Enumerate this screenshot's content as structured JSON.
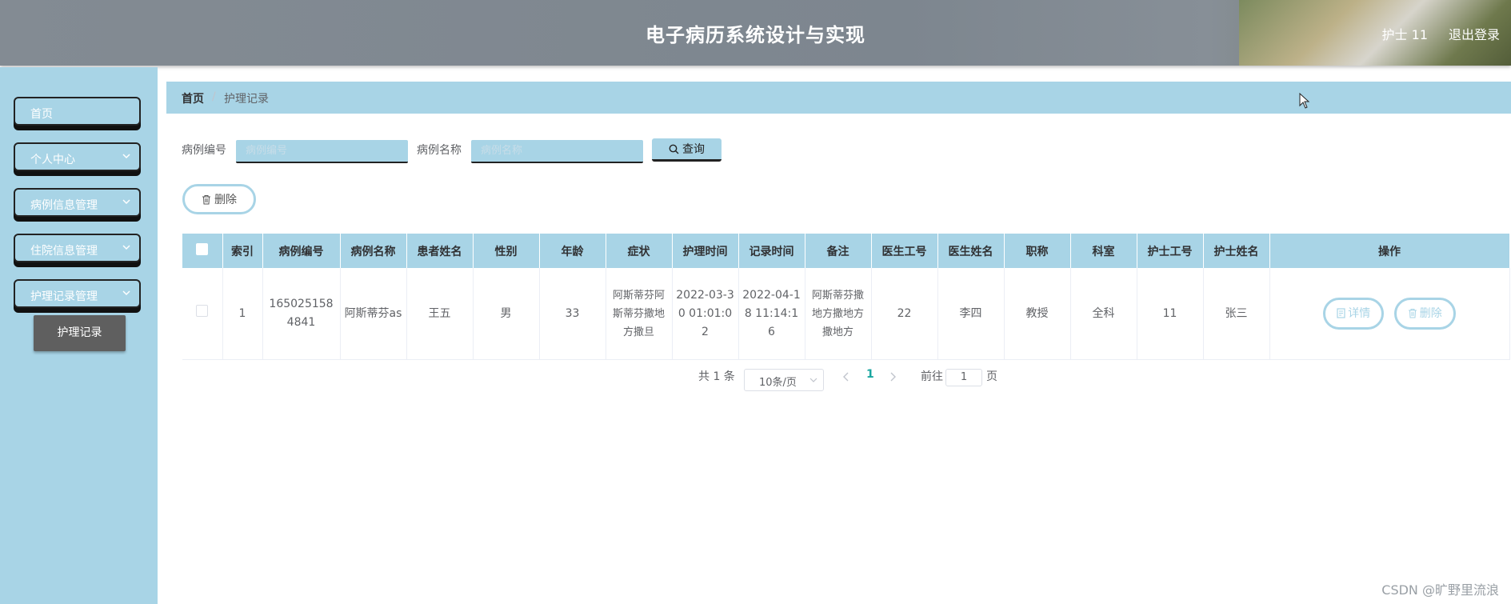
{
  "header": {
    "title": "电子病历系统设计与实现",
    "user": "护士 11",
    "logout": "退出登录"
  },
  "sidebar": {
    "items": [
      {
        "label": "首页"
      },
      {
        "label": "个人中心"
      },
      {
        "label": "病例信息管理"
      },
      {
        "label": "住院信息管理"
      },
      {
        "label": "护理记录管理"
      }
    ],
    "active_sub": "护理记录"
  },
  "breadcrumb": {
    "home": "首页",
    "current": "护理记录"
  },
  "search": {
    "field1_label": "病例编号",
    "field1_placeholder": "病例编号",
    "field2_label": "病例名称",
    "field2_placeholder": "病例名称",
    "query_label": "查询"
  },
  "toolbar": {
    "delete_label": "删除"
  },
  "table": {
    "columns": [
      "索引",
      "病例编号",
      "病例名称",
      "患者姓名",
      "性别",
      "年龄",
      "症状",
      "护理时间",
      "记录时间",
      "备注",
      "医生工号",
      "医生姓名",
      "职称",
      "科室",
      "护士工号",
      "护士姓名",
      "操作"
    ],
    "rows": [
      {
        "index": "1",
        "case_no": "1650251584841",
        "case_name": "阿斯蒂芬as",
        "patient": "王五",
        "gender": "男",
        "age": "33",
        "symptom": "阿斯蒂芬阿斯蒂芬撒地方撒旦",
        "care_time": "2022-03-30 01:01:02",
        "record_time": "2022-04-18 11:14:16",
        "remark": "阿斯蒂芬撒地方撒地方撒地方",
        "doctor_no": "22",
        "doctor_name": "李四",
        "title": "教授",
        "dept": "全科",
        "nurse_no": "11",
        "nurse_name": "张三",
        "detail_label": "详情",
        "delete_label": "删除"
      }
    ]
  },
  "pagination": {
    "total": "共 1 条",
    "page_size": "10条/页",
    "current": "1",
    "goto_prefix": "前往",
    "goto_value": "1",
    "goto_suffix": "页"
  },
  "watermark": "CSDN @旷野里流浪",
  "colors": {
    "accent": "#a8d4e6",
    "header": "#838b93",
    "sub_active": "#5f5f5f"
  }
}
